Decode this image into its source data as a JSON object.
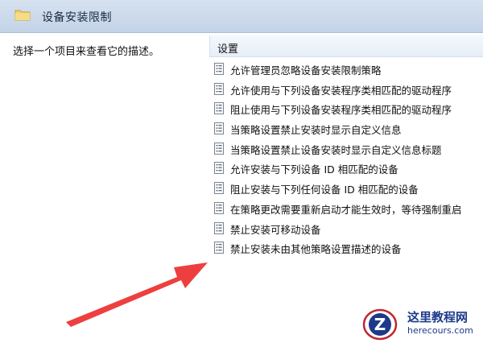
{
  "window": {
    "title": "设备安装限制"
  },
  "left_pane": {
    "description": "选择一个项目来查看它的描述。"
  },
  "right_pane": {
    "column_header": "设置",
    "items": [
      {
        "label": "允许管理员忽略设备安装限制策略"
      },
      {
        "label": "允许使用与下列设备安装程序类相匹配的驱动程序"
      },
      {
        "label": "阻止使用与下列设备安装程序类相匹配的驱动程序"
      },
      {
        "label": "当策略设置禁止安装时显示自定义信息"
      },
      {
        "label": "当策略设置禁止设备安装时显示自定义信息标题"
      },
      {
        "label": "允许安装与下列设备 ID 相匹配的设备"
      },
      {
        "label": "阻止安装与下列任何设备 ID 相匹配的设备"
      },
      {
        "label": "在策略更改需要重新启动才能生效时，等待强制重启"
      },
      {
        "label": "禁止安装可移动设备"
      },
      {
        "label": "禁止安装未由其他策略设置描述的设备"
      }
    ]
  },
  "watermark": {
    "name": "这里教程网",
    "url": "herecours.com"
  },
  "colors": {
    "arrow": "#ee3f3f",
    "header_bg": "#cbd9ea",
    "logo_blue": "#1d3a8a"
  }
}
